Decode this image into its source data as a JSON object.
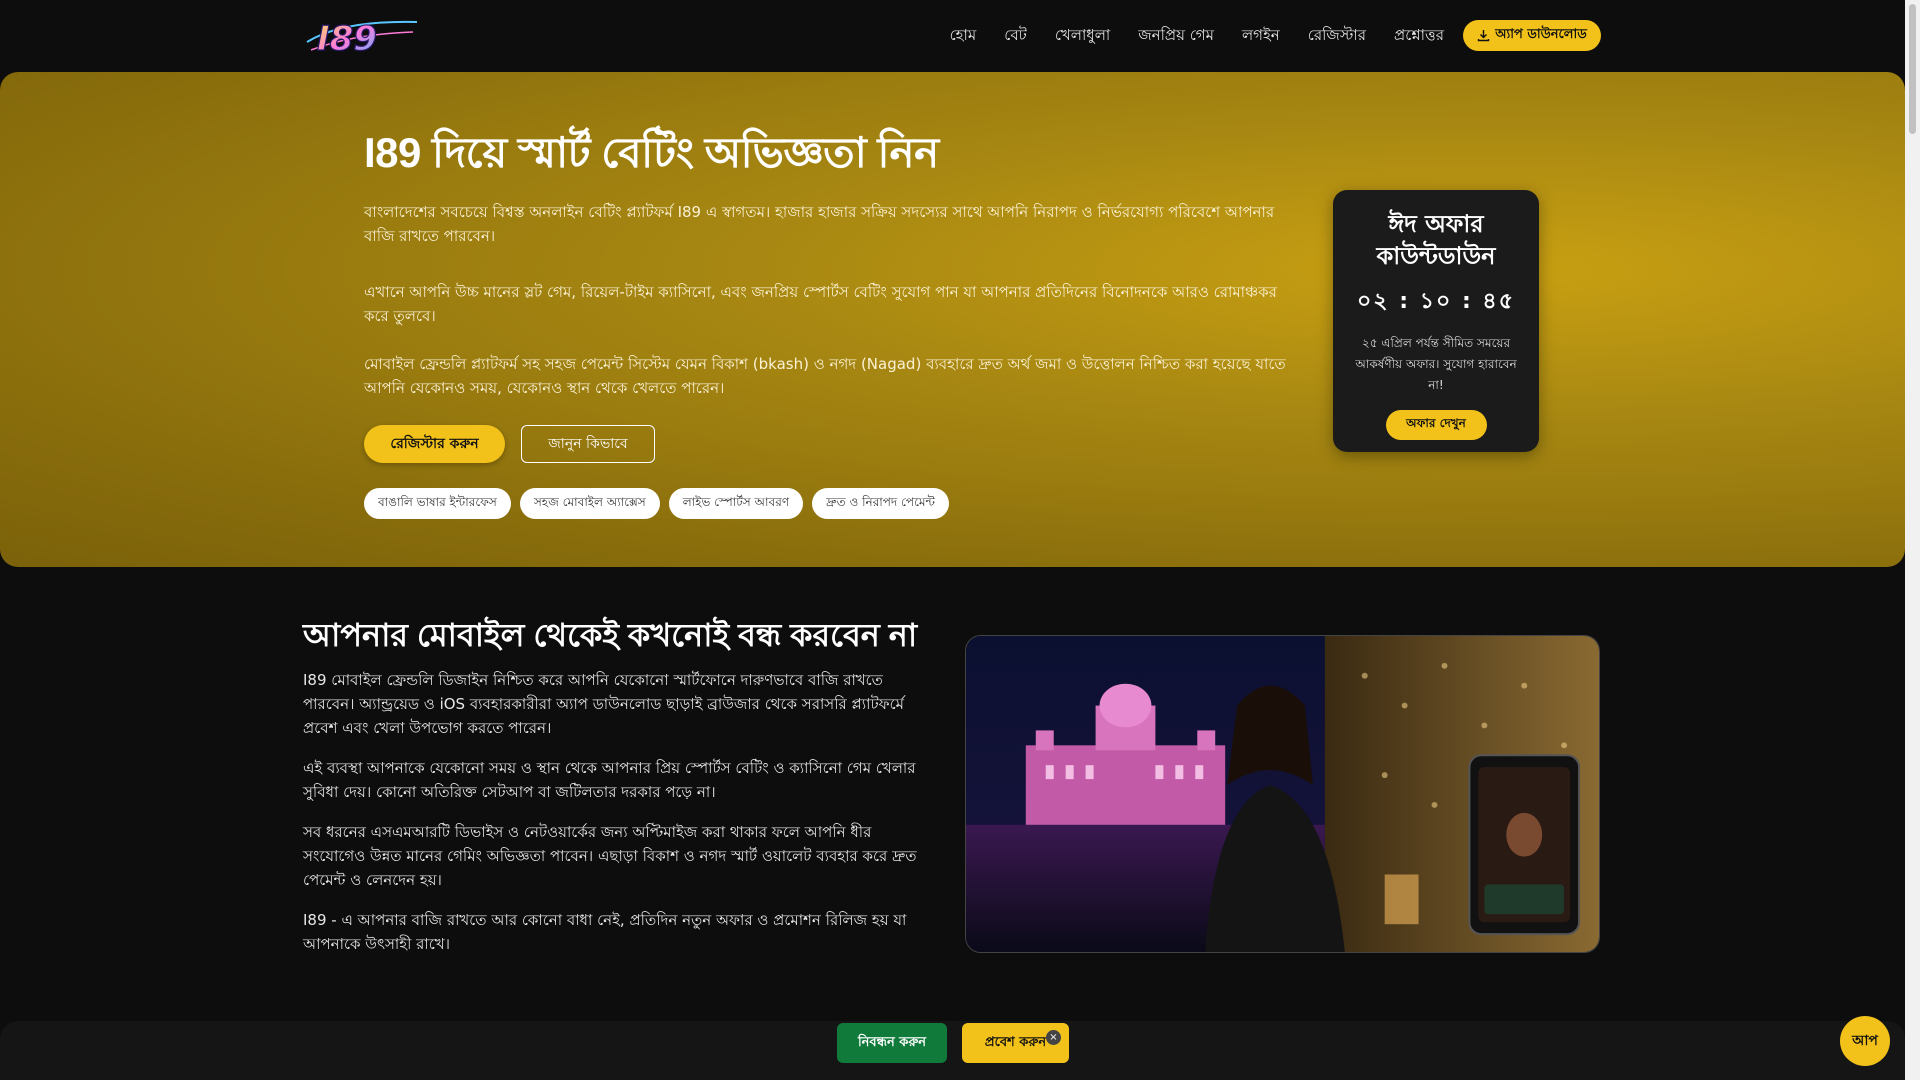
{
  "header": {
    "logo_text": "I89",
    "nav": [
      "হোম",
      "বেট",
      "খেলাধুলা",
      "জনপ্রিয় গেম",
      "লগইন",
      "রেজিস্টার",
      "প্রশ্নোত্তর"
    ],
    "download_label": "অ্যাপ ডাউনলোড",
    "download_icon": "download-icon"
  },
  "hero": {
    "title": "I89 দিয়ে স্মার্ট বেটিং অভিজ্ঞতা নিন",
    "p1": "বাংলাদেশের সবচেয়ে বিশ্বস্ত অনলাইন বেটিং প্ল্যাটফর্ম I89 এ স্বাগতম। হাজার হাজার সক্রিয় সদস্যের সাথে আপনি নিরাপদ ও নির্ভরযোগ্য পরিবেশে আপনার বাজি রাখতে পারবেন।",
    "p2": "এখানে আপনি উচ্চ মানের স্লট গেম, রিয়েল-টাইম ক্যাসিনো, এবং জনপ্রিয় স্পোর্টস বেটিং সুযোগ পান যা আপনার প্রতিদিনের বিনোদনকে আরও রোমাঞ্চকর করে তুলবে।",
    "p3": "মোবাইল ফ্রেন্ডলি প্ল্যাটফর্ম সহ সহজ পেমেন্ট সিস্টেম যেমন বিকাশ (bkash) ও নগদ (Nagad) ব্যবহারে দ্রুত অর্থ জমা ও উত্তোলন নিশ্চিত করা হয়েছে যাতে আপনি যেকোনও সময়, যেকোনও স্থান থেকে খেলতে পারেন।",
    "register_label": "রেজিস্টার করুন",
    "learn_label": "জানুন কিভাবে",
    "tags": [
      "বাঙালি ভাষার ইন্টারফেস",
      "সহজ মোবাইল অ্যাক্সেস",
      "লাইভ স্পোর্টস আবরণ",
      "দ্রুত ও নিরাপদ পেমেন্ট"
    ]
  },
  "countdown": {
    "title": "ঈদ অফার কাউন্টডাউন",
    "timer": "০২ : ১০ : ৪৫",
    "text": "২৫ এপ্রিল পর্যন্ত সীমিত সময়ের আকর্ষণীয় অফার। সুযোগ হারাবেন না!",
    "button_label": "অফার দেখুন"
  },
  "mobile": {
    "title": "আপনার মোবাইল থেকেই কখনোই বন্ধ করবেন না",
    "p1": "I89 মোবাইল ফ্রেন্ডলি ডিজাইন নিশ্চিত করে আপনি যেকোনো স্মার্টফোনে দারুণভাবে বাজি রাখতে পারবেন। অ্যান্ড্রয়েড ও iOS ব্যবহারকারীরা অ্যাপ ডাউনলোড ছাড়াই ব্রাউজার থেকে সরাসরি প্ল্যাটফর্মে প্রবেশ এবং খেলা উপভোগ করতে পারেন।",
    "p2": "এই ব্যবস্থা আপনাকে যেকোনো সময় ও স্থান থেকে আপনার প্রিয় স্পোর্টস বেটিং ও ক্যাসিনো গেম খেলার সুবিধা দেয়। কোনো অতিরিক্ত সেটআপ বা জটিলতার দরকার পড়ে না।",
    "p3": "সব ধরনের এসএমআরটি ডিভাইস ও নেটওয়ার্কের জন্য অপ্টিমাইজ করা থাকার ফলে আপনি ধীর সংযোগেও উন্নত মানের গেমিং অভিজ্ঞতা পাবেন। এছাড়া বিকাশ ও নগদ স্মার্ট ওয়ালেট ব্যবহার করে দ্রুত পেমেন্ট ও লেনদেন হয়।",
    "p4": "I89 - এ আপনার বাজি রাখতে আর কোনো বাধা নেই, প্রতিদিন নতুন অফার ও প্রমোশন রিলিজ হয় যা আপনাকে উৎসাহী রাখে।"
  },
  "sticky": {
    "register_label": "নিবন্ধন করুন",
    "login_label": "প্রবেশ করুন",
    "close": "×"
  },
  "chat": {
    "label": "আপ"
  },
  "colors": {
    "accent": "#f2c21a",
    "hero": "#a88812",
    "dark": "#0d0d0d",
    "green": "#0f7a3a"
  }
}
